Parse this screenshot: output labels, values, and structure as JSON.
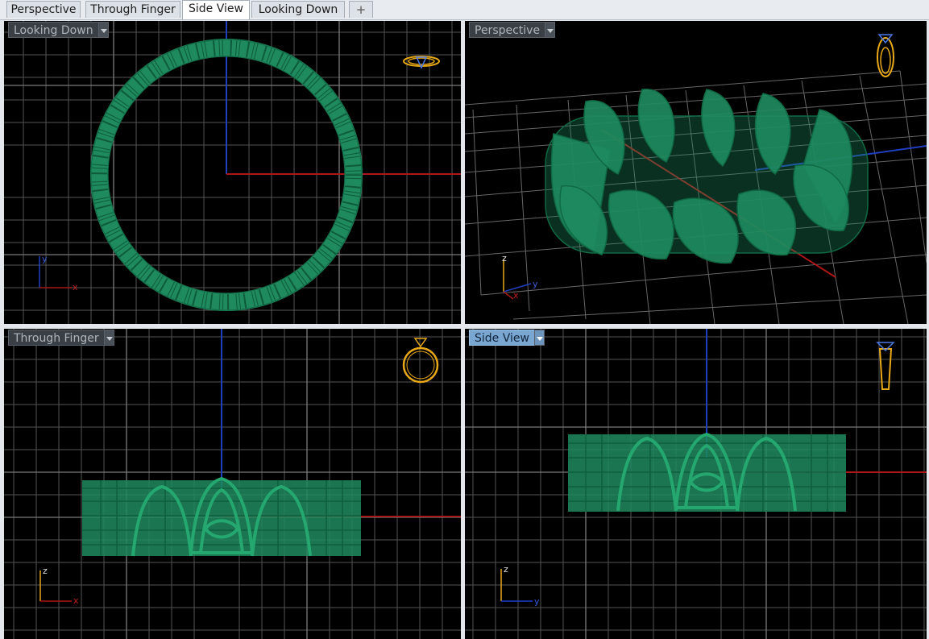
{
  "tabs": [
    {
      "label": "Perspective",
      "active": false
    },
    {
      "label": "Through Finger",
      "active": false
    },
    {
      "label": "Side View",
      "active": true
    },
    {
      "label": "Looking Down",
      "active": false
    },
    {
      "label": "+",
      "active": false
    }
  ],
  "viewports": {
    "top_left": {
      "label": "Looking Down",
      "axis_a": "y",
      "axis_b": "x",
      "active": false
    },
    "top_right": {
      "label": "Perspective",
      "axis_a": "z",
      "axis_b": "y",
      "axis_c": "x",
      "active": false
    },
    "bottom_left": {
      "label": "Through Finger",
      "axis_a": "z",
      "axis_b": "x",
      "active": false
    },
    "bottom_right": {
      "label": "Side View",
      "axis_a": "z",
      "axis_b": "y",
      "active": true
    }
  },
  "colors": {
    "background": "#000000",
    "grid": "#5b5b5b",
    "model": "#1e8a5e",
    "model_edge": "#0a5a3a",
    "axis_x": "#b01818",
    "axis_y": "#1f3fbf",
    "widget": "#e8a818",
    "active_label": "#7aa6d2"
  },
  "icons": {
    "view_widget": "ring-gizmo-icon",
    "dropdown": "chevron-down-icon",
    "add_tab": "plus-icon"
  }
}
